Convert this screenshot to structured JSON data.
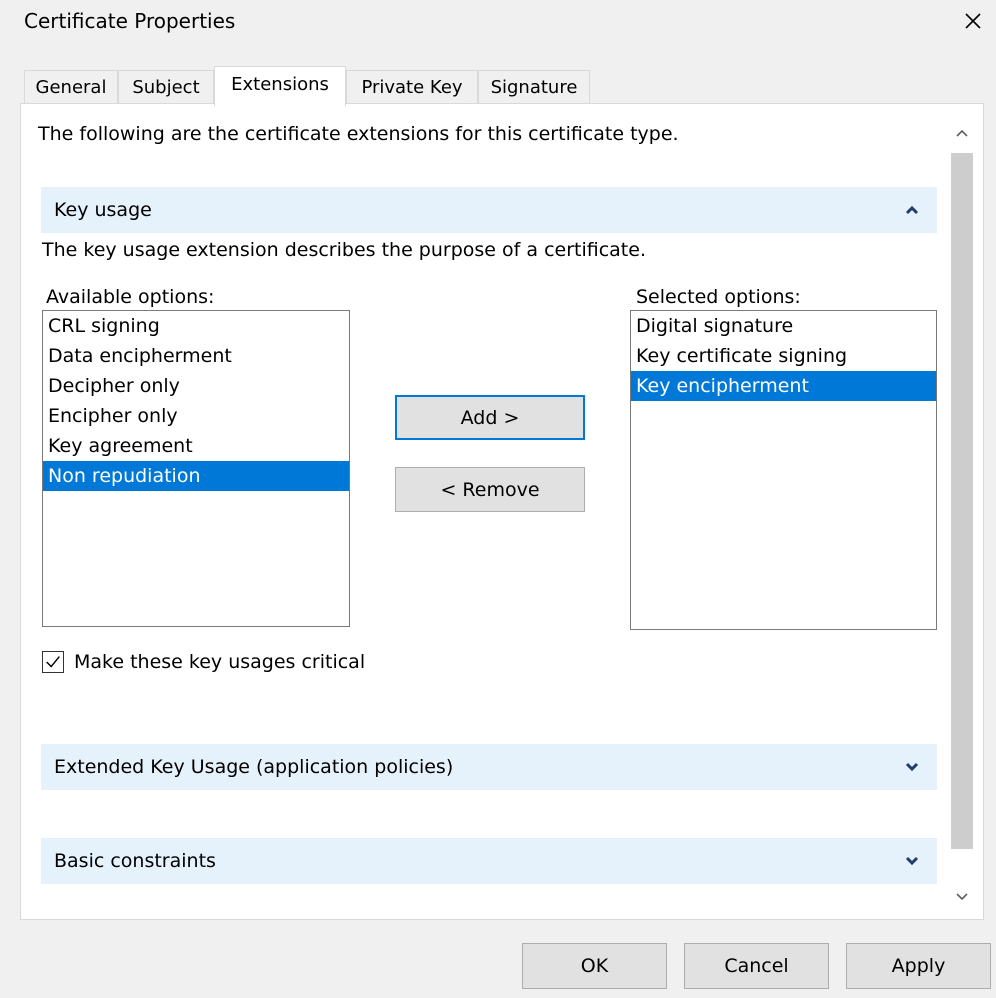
{
  "window": {
    "title": "Certificate Properties"
  },
  "tabs": [
    {
      "label": "General"
    },
    {
      "label": "Subject"
    },
    {
      "label": "Extensions"
    },
    {
      "label": "Private Key"
    },
    {
      "label": "Signature"
    }
  ],
  "active_tab": "Extensions",
  "extensions": {
    "intro": "The following are the certificate extensions for this certificate type.",
    "key_usage": {
      "header": "Key usage",
      "expanded": true,
      "description": "The key usage extension describes the purpose of a certificate.",
      "available_label": "Available options:",
      "available_options": [
        "CRL signing",
        "Data encipherment",
        "Decipher only",
        "Encipher only",
        "Key agreement",
        "Non repudiation"
      ],
      "available_selected": "Non repudiation",
      "selected_label": "Selected options:",
      "selected_options": [
        "Digital signature",
        "Key certificate signing",
        "Key encipherment"
      ],
      "selected_selected": "Key encipherment",
      "add_button": "Add >",
      "remove_button": "< Remove",
      "critical_checkbox": {
        "label": "Make these key usages critical",
        "checked": true
      }
    },
    "extended_key_usage": {
      "header": "Extended Key Usage (application policies)",
      "expanded": false
    },
    "basic_constraints": {
      "header": "Basic constraints",
      "expanded": false
    }
  },
  "footer": {
    "ok": "OK",
    "cancel": "Cancel",
    "apply": "Apply"
  },
  "colors": {
    "dialog_bg": "#f0f0f0",
    "section_header_bg": "#e5f1fb",
    "selection": "#0078d7",
    "chevron": "#1f3e6b"
  },
  "icons": {
    "close": "close-icon",
    "collapse": "chevron-up-icon",
    "expand": "chevron-down-icon",
    "checkbox": "checkmark-icon",
    "scroll_up": "scroll-up-arrow-icon",
    "scroll_down": "scroll-down-arrow-icon"
  }
}
